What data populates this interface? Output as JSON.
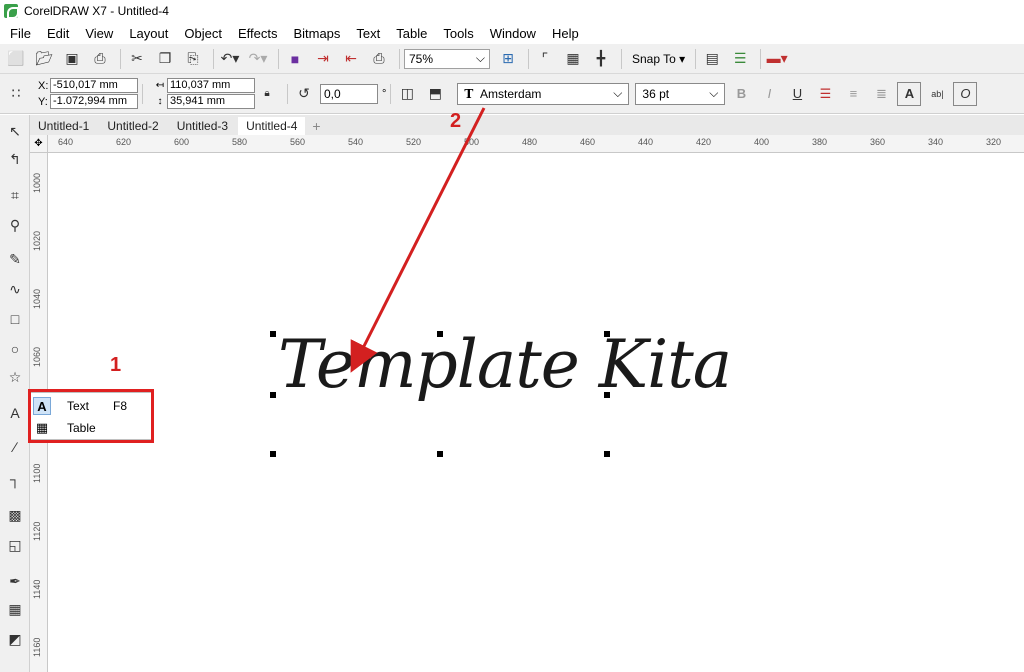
{
  "window": {
    "title": "CorelDRAW X7 - Untitled-4"
  },
  "menu": [
    "File",
    "Edit",
    "View",
    "Layout",
    "Object",
    "Effects",
    "Bitmaps",
    "Text",
    "Table",
    "Tools",
    "Window",
    "Help"
  ],
  "toolbar": {
    "zoom": "75%",
    "snap_to": "Snap To"
  },
  "properties": {
    "x": "-510,017 mm",
    "y": "-1.072,994 mm",
    "width": "110,037 mm",
    "height": "35,941 mm",
    "angle": "0,0",
    "angle_unit": "°",
    "font": "Amsterdam",
    "font_size": "36 pt"
  },
  "tabs": [
    "Untitled-1",
    "Untitled-2",
    "Untitled-3",
    "Untitled-4"
  ],
  "ruler_h": [
    "640",
    "620",
    "600",
    "580",
    "560",
    "540",
    "520",
    "500",
    "480",
    "460",
    "440",
    "420",
    "400",
    "380",
    "360",
    "340",
    "320"
  ],
  "ruler_v": [
    "1000",
    "1020",
    "1040",
    "1060",
    "1080",
    "1100",
    "1120",
    "1140",
    "1160"
  ],
  "canvas_text": "Template Kita",
  "flyout": {
    "text_label": "Text",
    "text_shortcut": "F8",
    "table_label": "Table"
  },
  "annotations": {
    "one": "1",
    "two": "2"
  },
  "colors": {
    "accent_red": "#e02020",
    "flyout_highlight": "#cfe3f7"
  }
}
